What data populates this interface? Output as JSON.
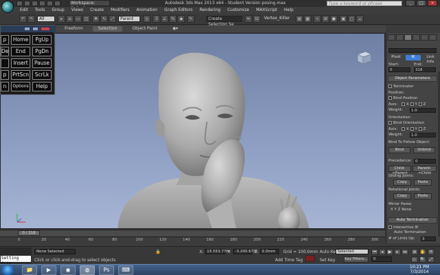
{
  "window": {
    "title": "Autodesk 3ds Max 2013 x64   - Student Version   posing.max",
    "workspace": "Workspace: Default",
    "search_placeholder": "Type a keyword or phrase"
  },
  "menu": [
    "Edit",
    "Tools",
    "Group",
    "Views",
    "Create",
    "Modifiers",
    "Animation",
    "Graph Editors",
    "Rendering",
    "Customize",
    "MAXScript",
    "Help"
  ],
  "toolbar": {
    "selection_filter": "All",
    "reference_coord": "Parent",
    "named_selection": "Create Selection Se",
    "layer": "Vertex_Killer"
  },
  "ribbon": {
    "tabs": [
      "Freeform",
      "Selection",
      "Object Paint"
    ]
  },
  "viewport": {
    "label": "[+] [Perspective] [Realistic]"
  },
  "onscreen_keyboard": {
    "rows": [
      [
        "p",
        "Home",
        "PgUp"
      ],
      [
        "Del",
        "End",
        "PgDn"
      ],
      [
        "",
        "Insert",
        "Pause"
      ],
      [
        "p",
        "PrtScn",
        "ScrLk"
      ],
      [
        "n",
        "Options",
        "Help"
      ]
    ]
  },
  "command_panel": {
    "tabs": [
      "Pivot",
      "IK",
      "Link Info"
    ],
    "start_label": "Start:",
    "end_label": "End:",
    "start_value": "0",
    "end_value": "318",
    "object_parameters": "Object Parameters",
    "terminator": "Terminator",
    "position_label": "Position:",
    "bind_position": "Bind Position",
    "axis_label": "Axis:",
    "weight_label": "Weight:",
    "weight_value": "1.0",
    "orientation_label": "Orientation:",
    "bind_orientation": "Bind Orientation",
    "bind_to_follow": "Bind To Follow Object:",
    "bind_btn": "Bind",
    "unbind_btn": "Unbind",
    "precedence_label": "Precedence:",
    "precedence_value": "0",
    "child_parent": "Child->Parent",
    "parent_child": "Parent->Child",
    "sliding_joints": "Sliding Joints:",
    "rotational_joints": "Rotational Joints:",
    "copy": "Copy",
    "paste": "Paste",
    "mirror_paste": "Mirror Paste:",
    "none": "None",
    "axes": [
      "X",
      "Y",
      "Z"
    ],
    "auto_termination": "Auto Termination",
    "interactive_ik": "Interactive IK",
    "auto_termination_chk": "Auto Termination",
    "links_up": "# of Links Up:",
    "links_up_value": "3"
  },
  "timeline": {
    "slider": "0 / 318",
    "ticks": [
      "0",
      "20",
      "40",
      "60",
      "80",
      "100",
      "120",
      "140",
      "160",
      "180",
      "200",
      "220",
      "240",
      "260",
      "280",
      "300"
    ]
  },
  "status": {
    "script_line": "Setting Orie",
    "none_selected": "None Selected",
    "prompt": "Click or click-and-drag to select objects",
    "x_label": "X:",
    "x_value": "15.553.77m",
    "y_label": "Y:",
    "y_value": "-3.200.67m",
    "z_label": "Z:",
    "z_value": "0.0mm",
    "grid": "Grid = 100.0mm",
    "add_time_tag": "Add Time Tag",
    "auto_key": "Auto Key",
    "key_mode": "Selected",
    "set_key": "Set Key",
    "key_filters": "Key Filters...",
    "frame": "0"
  },
  "taskbar": {
    "time": "10:21 PM",
    "date": "7/3/2014"
  },
  "colors": {
    "viewport_top": "#6e7fa3",
    "viewport_bottom": "#a7b5d4",
    "active_tab": "#3d7fd6",
    "auto_key": "#7a2020"
  }
}
